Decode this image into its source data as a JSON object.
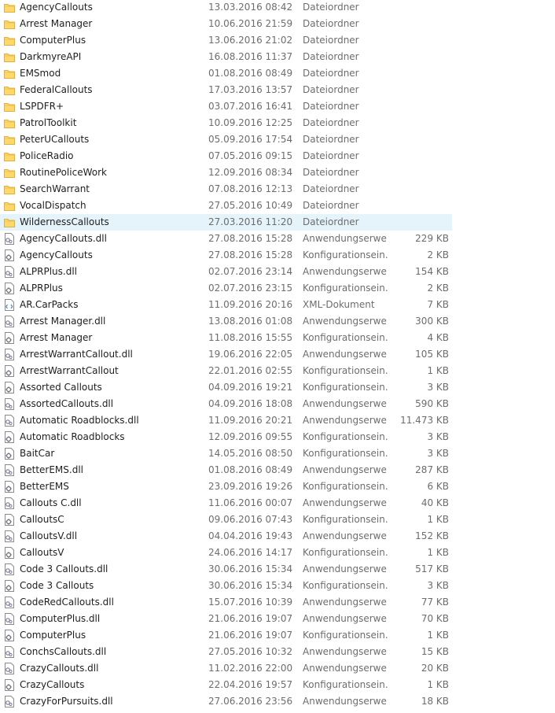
{
  "rows": [
    {
      "name": "AgencyCallouts",
      "date": "13.03.2016 08:42",
      "type": "Dateiordner",
      "size": "",
      "icon": "folder-icon"
    },
    {
      "name": "Arrest Manager",
      "date": "10.06.2016 21:59",
      "type": "Dateiordner",
      "size": "",
      "icon": "folder-icon"
    },
    {
      "name": "ComputerPlus",
      "date": "13.06.2016 21:02",
      "type": "Dateiordner",
      "size": "",
      "icon": "folder-icon"
    },
    {
      "name": "DarkmyreAPI",
      "date": "16.08.2016 11:37",
      "type": "Dateiordner",
      "size": "",
      "icon": "folder-icon"
    },
    {
      "name": "EMSmod",
      "date": "01.08.2016 08:49",
      "type": "Dateiordner",
      "size": "",
      "icon": "folder-icon"
    },
    {
      "name": "FederalCallouts",
      "date": "17.03.2016 13:57",
      "type": "Dateiordner",
      "size": "",
      "icon": "folder-icon"
    },
    {
      "name": "LSPDFR+",
      "date": "03.07.2016 16:41",
      "type": "Dateiordner",
      "size": "",
      "icon": "folder-icon"
    },
    {
      "name": "PatrolToolkit",
      "date": "10.09.2016 12:25",
      "type": "Dateiordner",
      "size": "",
      "icon": "folder-icon"
    },
    {
      "name": "PeterUCallouts",
      "date": "05.09.2016 17:54",
      "type": "Dateiordner",
      "size": "",
      "icon": "folder-icon"
    },
    {
      "name": "PoliceRadio",
      "date": "07.05.2016 09:15",
      "type": "Dateiordner",
      "size": "",
      "icon": "folder-icon"
    },
    {
      "name": "RoutinePoliceWork",
      "date": "12.09.2016 08:34",
      "type": "Dateiordner",
      "size": "",
      "icon": "folder-icon"
    },
    {
      "name": "SearchWarrant",
      "date": "07.08.2016 12:13",
      "type": "Dateiordner",
      "size": "",
      "icon": "folder-icon"
    },
    {
      "name": "VocalDispatch",
      "date": "27.05.2016 10:49",
      "type": "Dateiordner",
      "size": "",
      "icon": "folder-icon"
    },
    {
      "name": "WildernessCallouts",
      "date": "27.03.2016 11:20",
      "type": "Dateiordner",
      "size": "",
      "icon": "folder-icon",
      "selected": true
    },
    {
      "name": "AgencyCallouts.dll",
      "date": "27.08.2016 15:28",
      "type": "Anwendungserwe...",
      "size": "229 KB",
      "icon": "dll-file-icon"
    },
    {
      "name": "AgencyCallouts",
      "date": "27.08.2016 15:28",
      "type": "Konfigurationsein...",
      "size": "2 KB",
      "icon": "config-file-icon"
    },
    {
      "name": "ALPRPlus.dll",
      "date": "02.07.2016 23:14",
      "type": "Anwendungserwe...",
      "size": "154 KB",
      "icon": "dll-file-icon"
    },
    {
      "name": "ALPRPlus",
      "date": "02.07.2016 23:15",
      "type": "Konfigurationsein...",
      "size": "2 KB",
      "icon": "config-file-icon"
    },
    {
      "name": "AR.CarPacks",
      "date": "11.09.2016 20:16",
      "type": "XML-Dokument",
      "size": "7 KB",
      "icon": "xml-file-icon"
    },
    {
      "name": "Arrest Manager.dll",
      "date": "13.08.2016 01:08",
      "type": "Anwendungserwe...",
      "size": "300 KB",
      "icon": "dll-file-icon"
    },
    {
      "name": "Arrest Manager",
      "date": "11.08.2016 15:55",
      "type": "Konfigurationsein...",
      "size": "4 KB",
      "icon": "config-file-icon"
    },
    {
      "name": "ArrestWarrantCallout.dll",
      "date": "19.06.2016 22:05",
      "type": "Anwendungserwe...",
      "size": "105 KB",
      "icon": "dll-file-icon"
    },
    {
      "name": "ArrestWarrantCallout",
      "date": "22.01.2016 02:55",
      "type": "Konfigurationsein...",
      "size": "1 KB",
      "icon": "config-file-icon"
    },
    {
      "name": "Assorted Callouts",
      "date": "04.09.2016 19:21",
      "type": "Konfigurationsein...",
      "size": "3 KB",
      "icon": "config-file-icon"
    },
    {
      "name": "AssortedCallouts.dll",
      "date": "04.09.2016 18:08",
      "type": "Anwendungserwe...",
      "size": "590 KB",
      "icon": "dll-file-icon"
    },
    {
      "name": "Automatic Roadblocks.dll",
      "date": "11.09.2016 20:21",
      "type": "Anwendungserwe...",
      "size": "11.473 KB",
      "icon": "dll-file-icon"
    },
    {
      "name": "Automatic Roadblocks",
      "date": "12.09.2016 09:55",
      "type": "Konfigurationsein...",
      "size": "3 KB",
      "icon": "config-file-icon"
    },
    {
      "name": "BaitCar",
      "date": "14.05.2016 08:50",
      "type": "Konfigurationsein...",
      "size": "3 KB",
      "icon": "config-file-icon"
    },
    {
      "name": "BetterEMS.dll",
      "date": "01.08.2016 08:49",
      "type": "Anwendungserwe...",
      "size": "287 KB",
      "icon": "dll-file-icon"
    },
    {
      "name": "BetterEMS",
      "date": "23.09.2016 19:26",
      "type": "Konfigurationsein...",
      "size": "6 KB",
      "icon": "config-file-icon"
    },
    {
      "name": "Callouts C.dll",
      "date": "11.06.2016 00:07",
      "type": "Anwendungserwe...",
      "size": "40 KB",
      "icon": "dll-file-icon"
    },
    {
      "name": "CalloutsC",
      "date": "09.06.2016 07:43",
      "type": "Konfigurationsein...",
      "size": "1 KB",
      "icon": "config-file-icon"
    },
    {
      "name": "CalloutsV.dll",
      "date": "04.04.2016 19:43",
      "type": "Anwendungserwe...",
      "size": "152 KB",
      "icon": "dll-file-icon"
    },
    {
      "name": "CalloutsV",
      "date": "24.06.2016 14:17",
      "type": "Konfigurationsein...",
      "size": "1 KB",
      "icon": "config-file-icon"
    },
    {
      "name": "Code 3 Callouts.dll",
      "date": "30.06.2016 15:34",
      "type": "Anwendungserwe...",
      "size": "517 KB",
      "icon": "dll-file-icon"
    },
    {
      "name": "Code 3 Callouts",
      "date": "30.06.2016 15:34",
      "type": "Konfigurationsein...",
      "size": "3 KB",
      "icon": "config-file-icon"
    },
    {
      "name": "CodeRedCallouts.dll",
      "date": "15.07.2016 10:39",
      "type": "Anwendungserwe...",
      "size": "77 KB",
      "icon": "dll-file-icon"
    },
    {
      "name": "ComputerPlus.dll",
      "date": "21.06.2016 19:07",
      "type": "Anwendungserwe...",
      "size": "70 KB",
      "icon": "dll-file-icon"
    },
    {
      "name": "ComputerPlus",
      "date": "21.06.2016 19:07",
      "type": "Konfigurationsein...",
      "size": "1 KB",
      "icon": "config-file-icon"
    },
    {
      "name": "ConchsCallouts.dll",
      "date": "27.05.2016 10:32",
      "type": "Anwendungserwe...",
      "size": "15 KB",
      "icon": "dll-file-icon"
    },
    {
      "name": "CrazyCallouts.dll",
      "date": "11.02.2016 22:00",
      "type": "Anwendungserwe...",
      "size": "20 KB",
      "icon": "dll-file-icon"
    },
    {
      "name": "CrazyCallouts",
      "date": "22.04.2016 19:57",
      "type": "Konfigurationsein...",
      "size": "1 KB",
      "icon": "config-file-icon"
    },
    {
      "name": "CrazyForPursuits.dll",
      "date": "27.06.2016 23:56",
      "type": "Anwendungserwe...",
      "size": "18 KB",
      "icon": "dll-file-icon"
    }
  ]
}
